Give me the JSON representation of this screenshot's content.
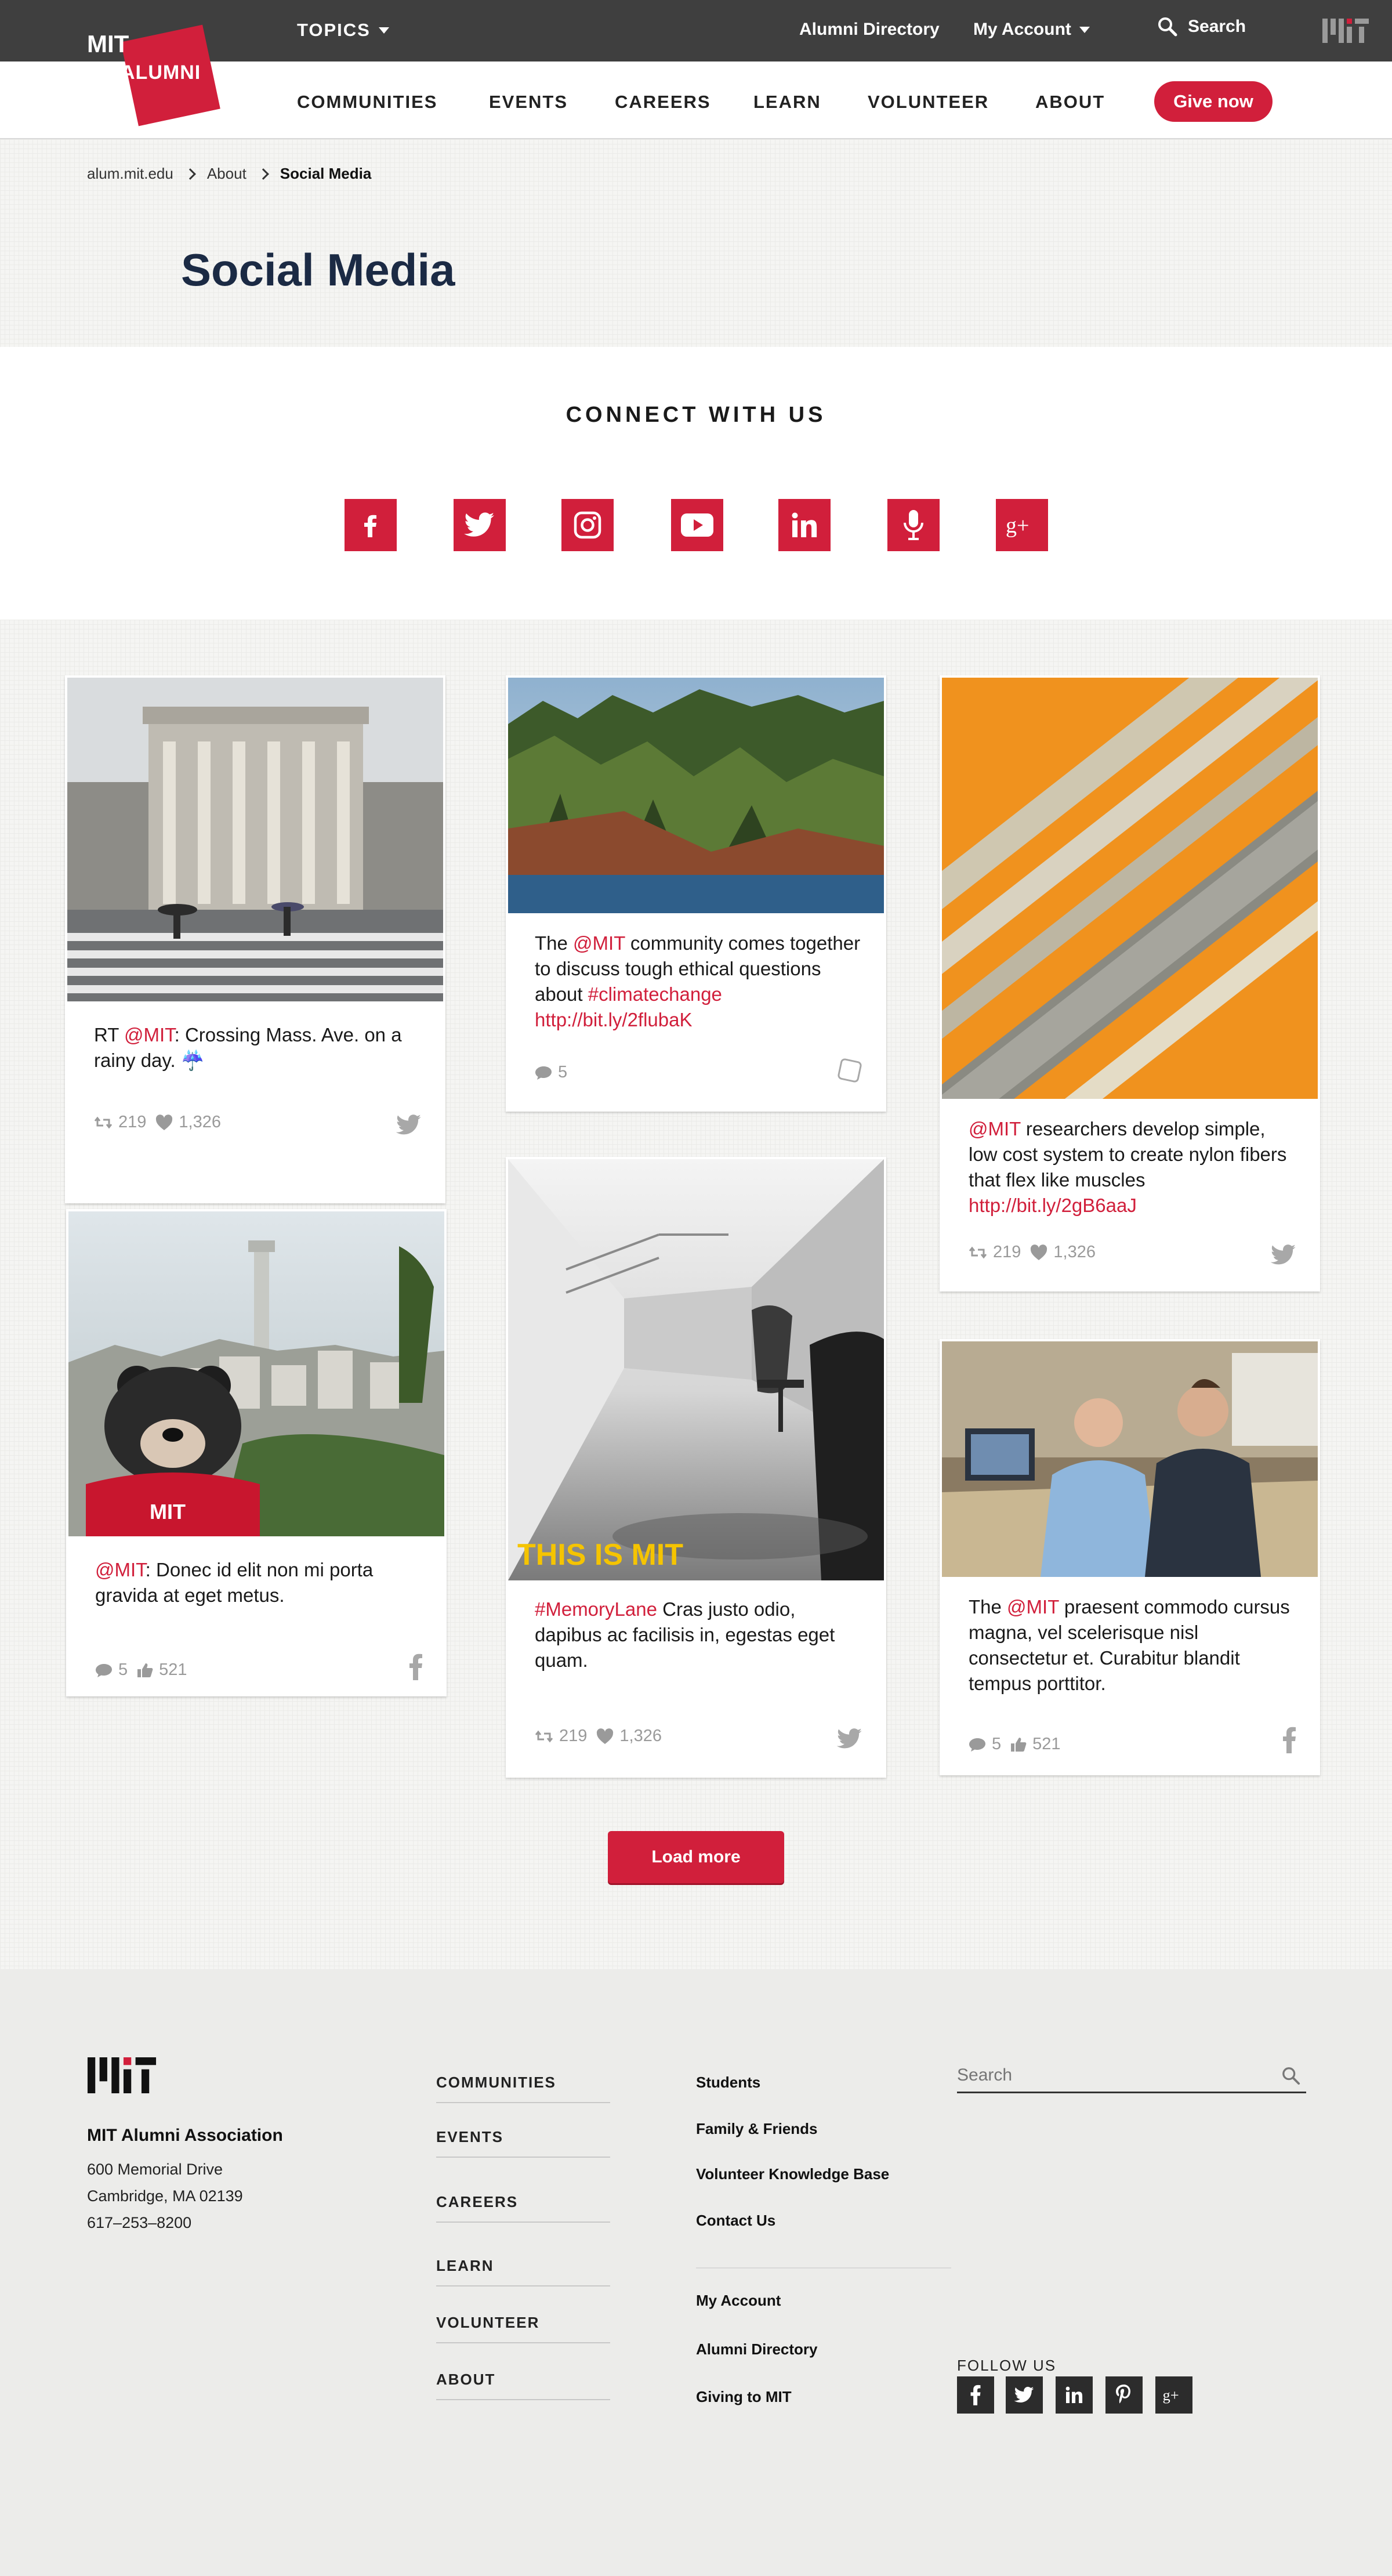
{
  "topbar": {
    "topics": "TOPICS",
    "alumni_directory": "Alumni Directory",
    "my_account": "My Account",
    "search": "Search"
  },
  "logo": {
    "mit": "MIT",
    "alumni": "ALUMNI"
  },
  "nav": {
    "items": [
      "COMMUNITIES",
      "EVENTS",
      "CAREERS",
      "LEARN",
      "VOLUNTEER",
      "ABOUT"
    ],
    "give_now": "Give now"
  },
  "breadcrumb": [
    "alum.mit.edu",
    "About",
    "Social Media"
  ],
  "page_title": "Social Media",
  "connect": {
    "title": "CONNECT WITH US",
    "icons": [
      "facebook-icon",
      "twitter-icon",
      "instagram-icon",
      "youtube-icon",
      "linkedin-icon",
      "podcast-mic-icon",
      "google-plus-icon"
    ]
  },
  "brand_red": "#d11f3b",
  "feed": {
    "card1": {
      "pre": "RT ",
      "mention": "@MIT",
      "post": ": Crossing Mass. Ave. on a rainy day. ",
      "emoji": "☔",
      "retweets": "219",
      "likes": "1,326",
      "source": "twitter-icon"
    },
    "card2": {
      "pre": "The ",
      "mention": "@MIT",
      "mid": " community comes together to discuss tough ethical questions about ",
      "hashtag": "#climatechange",
      "link": "http://bit.ly/2flubaK",
      "comments": "5",
      "source": "instagram-icon"
    },
    "card3": {
      "mention": "@MIT",
      "post": " researchers develop simple, low cost system to create nylon fibers that flex like muscles ",
      "link": "http://bit.ly/2gB6aaJ",
      "retweets": "219",
      "likes": "1,326",
      "source": "twitter-icon"
    },
    "card4": {
      "mention": "@MIT",
      "post": ": Donec id elit non mi porta gravida at eget metus.",
      "comments": "5",
      "thumbs": "521",
      "source": "facebook-icon"
    },
    "card5": {
      "overlay": "THIS IS MIT",
      "hashtag": "#MemoryLane",
      "post": " Cras justo odio, dapibus ac facilisis in, egestas eget quam.",
      "retweets": "219",
      "likes": "1,326",
      "source": "twitter-icon"
    },
    "card6": {
      "pre": "The ",
      "mention": "@MIT",
      "post": " praesent commodo cursus magna, vel scelerisque nisl consectetur et. Curabitur blandit tempus porttitor.",
      "comments": "5",
      "thumbs": "521",
      "source": "facebook-icon"
    },
    "load_more": "Load more"
  },
  "footer": {
    "org": "MIT Alumni Association",
    "address": [
      "600 Memorial Drive",
      "Cambridge, MA 02139",
      "617–253–8200"
    ],
    "nav": [
      "COMMUNITIES",
      "EVENTS",
      "CAREERS",
      "LEARN",
      "VOLUNTEER",
      "ABOUT"
    ],
    "links_top": [
      "Students",
      "Family & Friends",
      "Volunteer Knowledge Base",
      "Contact Us"
    ],
    "links_bottom": [
      "My Account",
      "Alumni Directory",
      "Giving to MIT"
    ],
    "search_placeholder": "Search",
    "follow_us": "FOLLOW US",
    "social": [
      "facebook-icon",
      "twitter-icon",
      "linkedin-icon",
      "pinterest-icon",
      "google-plus-icon"
    ]
  }
}
